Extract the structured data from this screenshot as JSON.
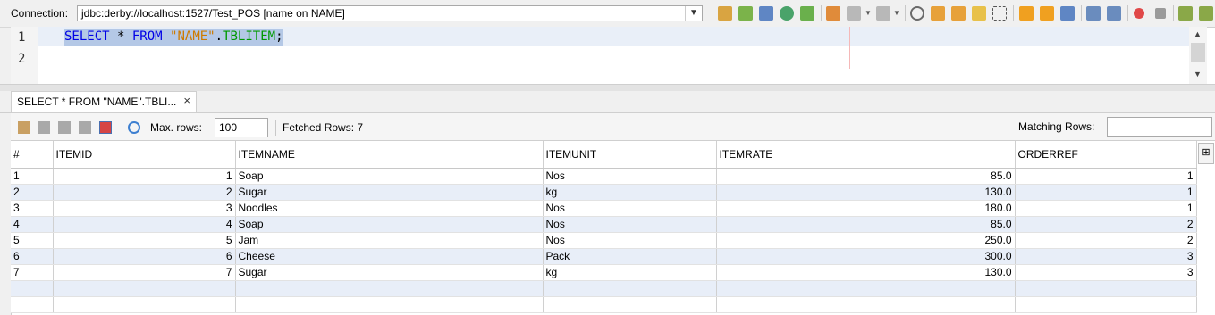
{
  "connection": {
    "label": "Connection:",
    "value": "jdbc:derby://localhost:1527/Test_POS [name on NAME]"
  },
  "editor": {
    "line_numbers": [
      "1",
      "2"
    ],
    "sql": {
      "kw_select": "SELECT",
      "star": " * ",
      "kw_from": "FROM",
      "schema": "\"NAME\"",
      "dot": ".",
      "table": "TBLITEM",
      "semi": ";"
    }
  },
  "result_tab": {
    "label": "SELECT * FROM \"NAME\".TBLI...",
    "close": "×"
  },
  "result_toolbar": {
    "max_rows_label": "Max. rows:",
    "max_rows_value": "100",
    "fetched_label": "Fetched Rows: 7",
    "matching_label": "Matching Rows:"
  },
  "table": {
    "columns": [
      "#",
      "ITEMID",
      "ITEMNAME",
      "ITEMUNIT",
      "ITEMRATE",
      "ORDERREF"
    ],
    "rows": [
      [
        "1",
        "1",
        "Soap",
        "Nos",
        "85.0",
        "1"
      ],
      [
        "2",
        "2",
        "Sugar",
        "kg",
        "130.0",
        "1"
      ],
      [
        "3",
        "3",
        "Noodles",
        "Nos",
        "180.0",
        "1"
      ],
      [
        "4",
        "4",
        "Soap",
        "Nos",
        "85.0",
        "2"
      ],
      [
        "5",
        "5",
        "Jam",
        "Nos",
        "250.0",
        "2"
      ],
      [
        "6",
        "6",
        "Cheese",
        "Pack",
        "300.0",
        "3"
      ],
      [
        "7",
        "7",
        "Sugar",
        "kg",
        "130.0",
        "3"
      ]
    ]
  },
  "colors": {
    "selection": "#b4c8e6",
    "keyword": "#0000e6",
    "string": "#ce7b00",
    "identifier": "#009900",
    "row_alt": "#e8eef8"
  }
}
